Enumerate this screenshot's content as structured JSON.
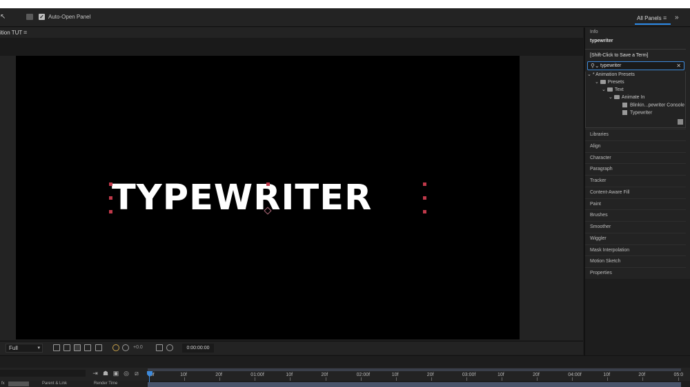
{
  "toolbar": {
    "auto_open_label": "Auto-Open Panel",
    "auto_open_checked": "✓",
    "workspace_label": "All Panels",
    "menu_glyph": "≡",
    "overflow_glyph": "»",
    "arrow_glyph": "↖"
  },
  "composition": {
    "tab_label": "ition TUT",
    "tab_menu_glyph": "≡",
    "canvas_text": "TYPEWRITER"
  },
  "viewer_bar": {
    "resolution": "Full",
    "caret": "▾",
    "exposure": "+0.0",
    "timecode": "0:00:00:00"
  },
  "timeline": {
    "col_parent": "Parent & Link",
    "col_render": "Render Time",
    "fx_label": "fx",
    "ticks": [
      "00f",
      "10f",
      "20f",
      "01:00f",
      "10f",
      "20f",
      "02:00f",
      "10f",
      "20f",
      "03:00f",
      "10f",
      "20f",
      "04:00f",
      "10f",
      "20f",
      "05:0"
    ]
  },
  "effects_presets": {
    "info_label": "Info",
    "query_display": "typewriter",
    "hint": "[Shift-Click to Save a Term]",
    "search_value": "typewriter",
    "search_icon": "🔍",
    "clear_glyph": "✕",
    "tree": [
      {
        "toggle": "⌄",
        "label": "* Animation Presets"
      },
      {
        "toggle": "⌄",
        "label": "Presets"
      },
      {
        "toggle": "⌄",
        "label": "Text"
      },
      {
        "toggle": "⌄",
        "label": "Animate In"
      },
      {
        "toggle": "",
        "label": "Blinkin...pewriter Console"
      },
      {
        "toggle": "",
        "label": "Typewriter"
      }
    ]
  },
  "panels": [
    "Libraries",
    "Align",
    "Character",
    "Paragraph",
    "Tracker",
    "Content-Aware Fill",
    "Paint",
    "Brushes",
    "Smoother",
    "Wiggler",
    "Mask Interpolation",
    "Motion Sketch",
    "Properties"
  ],
  "colors": {
    "accent": "#2d8ceb",
    "canvas": "#000000",
    "handle": "#c0394a",
    "panel_bg": "#232323"
  }
}
